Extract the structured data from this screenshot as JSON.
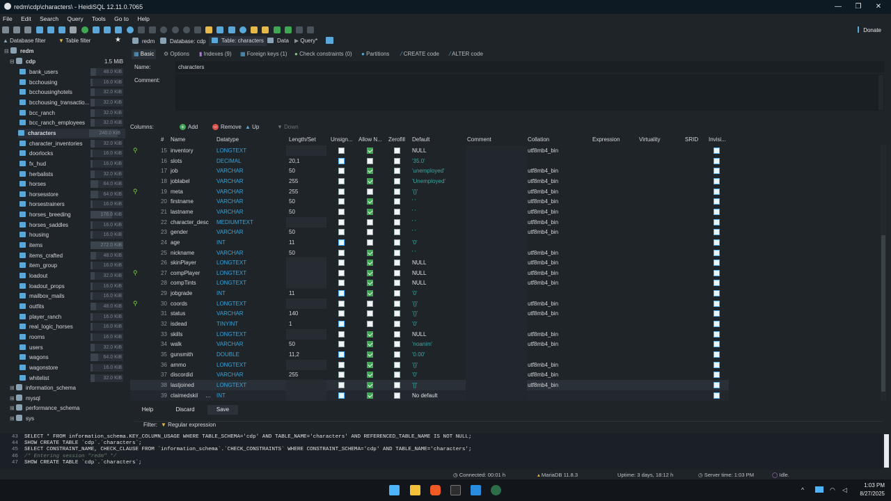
{
  "window": {
    "title": "redm\\cdp\\characters\\ - HeidiSQL 12.11.0.7065",
    "min": "—",
    "max": "❐",
    "close": "✕"
  },
  "menu": [
    "File",
    "Edit",
    "Search",
    "Query",
    "Tools",
    "Go to",
    "Help"
  ],
  "donate": "Donate",
  "navbar": {
    "db_filter": "Database filter",
    "table_filter": "Table filter",
    "redm": "redm",
    "database": "Database: cdp",
    "table": "Table: characters",
    "data": "Data",
    "query": "Query*"
  },
  "tree": {
    "root": "redm",
    "db": "cdp",
    "db_size": "1.5 MiB",
    "tables": [
      {
        "name": "bank_users",
        "size": "48.0 KiB",
        "fill": 0.18
      },
      {
        "name": "bcchousing",
        "size": "16.0 KiB",
        "fill": 0.06
      },
      {
        "name": "bcchousinghotels",
        "size": "32.0 KiB",
        "fill": 0.12
      },
      {
        "name": "bcchousing_transactio...",
        "size": "32.0 KiB",
        "fill": 0.12
      },
      {
        "name": "bcc_ranch",
        "size": "32.0 KiB",
        "fill": 0.12
      },
      {
        "name": "bcc_ranch_employees",
        "size": "32.0 KiB",
        "fill": 0.12
      },
      {
        "name": "characters",
        "size": "240.0 KiB",
        "fill": 0.88
      },
      {
        "name": "character_inventories",
        "size": "32.0 KiB",
        "fill": 0.12
      },
      {
        "name": "doorlocks",
        "size": "16.0 KiB",
        "fill": 0.06
      },
      {
        "name": "fx_hud",
        "size": "16.0 KiB",
        "fill": 0.06
      },
      {
        "name": "herbalists",
        "size": "32.0 KiB",
        "fill": 0.12
      },
      {
        "name": "horses",
        "size": "64.0 KiB",
        "fill": 0.24
      },
      {
        "name": "horsesstore",
        "size": "64.0 KiB",
        "fill": 0.24
      },
      {
        "name": "horsestrainers",
        "size": "16.0 KiB",
        "fill": 0.06
      },
      {
        "name": "horses_breeding",
        "size": "176.0 KiB",
        "fill": 0.65
      },
      {
        "name": "horses_saddles",
        "size": "16.0 KiB",
        "fill": 0.06
      },
      {
        "name": "housing",
        "size": "16.0 KiB",
        "fill": 0.06
      },
      {
        "name": "items",
        "size": "272.0 KiB",
        "fill": 1.0
      },
      {
        "name": "items_crafted",
        "size": "48.0 KiB",
        "fill": 0.18
      },
      {
        "name": "item_group",
        "size": "16.0 KiB",
        "fill": 0.06
      },
      {
        "name": "loadout",
        "size": "32.0 KiB",
        "fill": 0.12
      },
      {
        "name": "loadout_props",
        "size": "16.0 KiB",
        "fill": 0.06
      },
      {
        "name": "mailbox_mails",
        "size": "16.0 KiB",
        "fill": 0.06
      },
      {
        "name": "outfits",
        "size": "48.0 KiB",
        "fill": 0.18
      },
      {
        "name": "player_ranch",
        "size": "16.0 KiB",
        "fill": 0.06
      },
      {
        "name": "real_logic_horses",
        "size": "16.0 KiB",
        "fill": 0.06
      },
      {
        "name": "rooms",
        "size": "16.0 KiB",
        "fill": 0.06
      },
      {
        "name": "users",
        "size": "32.0 KiB",
        "fill": 0.12
      },
      {
        "name": "wagons",
        "size": "64.0 KiB",
        "fill": 0.24
      },
      {
        "name": "wagonstore",
        "size": "16.0 KiB",
        "fill": 0.06
      },
      {
        "name": "whitelist",
        "size": "32.0 KiB",
        "fill": 0.12
      }
    ],
    "other_dbs": [
      "information_schema",
      "mysql",
      "performance_schema",
      "sys"
    ]
  },
  "tabs": [
    "Basic",
    "Options",
    "Indexes (9)",
    "Foreign keys (1)",
    "Check constraints (0)",
    "Partitions",
    "CREATE code",
    "ALTER code"
  ],
  "form": {
    "name_label": "Name:",
    "name_value": "characters",
    "comment_label": "Comment:"
  },
  "columns_bar": {
    "label": "Columns:",
    "add": "Add",
    "remove": "Remove",
    "up": "Up",
    "down": "Down"
  },
  "grid_headers": [
    "#",
    "Name",
    "Datatype",
    "Length/Set",
    "Unsign...",
    "Allow N...",
    "Zerofill",
    "Default",
    "Comment",
    "Collation",
    "Expression",
    "Virtuality",
    "SRID",
    "Invisi..."
  ],
  "rows": [
    {
      "n": "15",
      "name": "inventory",
      "type": "LONGTEXT",
      "len": "",
      "uns": false,
      "null": true,
      "def": "NULL",
      "col": "utf8mb4_bin",
      "key": true
    },
    {
      "n": "16",
      "name": "slots",
      "type": "DECIMAL",
      "len": "20,1",
      "uns": true,
      "null": false,
      "def": "'35.0'",
      "col": "",
      "key": false
    },
    {
      "n": "17",
      "name": "job",
      "type": "VARCHAR",
      "len": "50",
      "uns": false,
      "null": true,
      "def": "'unemployed'",
      "col": "utf8mb4_bin",
      "key": false
    },
    {
      "n": "18",
      "name": "joblabel",
      "type": "VARCHAR",
      "len": "255",
      "uns": false,
      "null": true,
      "def": "'Unemployed'",
      "col": "utf8mb4_bin",
      "key": false
    },
    {
      "n": "19",
      "name": "meta",
      "type": "VARCHAR",
      "len": "255",
      "uns": false,
      "null": false,
      "def": "'{}'",
      "col": "utf8mb4_bin",
      "key": true
    },
    {
      "n": "20",
      "name": "firstname",
      "type": "VARCHAR",
      "len": "50",
      "uns": false,
      "null": true,
      "def": "' '",
      "col": "utf8mb4_bin",
      "key": false
    },
    {
      "n": "21",
      "name": "lastname",
      "type": "VARCHAR",
      "len": "50",
      "uns": false,
      "null": true,
      "def": "' '",
      "col": "utf8mb4_bin",
      "key": false
    },
    {
      "n": "22",
      "name": "character_desc",
      "type": "MEDIUMTEXT",
      "len": "",
      "uns": false,
      "null": false,
      "def": "' '",
      "col": "utf8mb4_bin",
      "key": false
    },
    {
      "n": "23",
      "name": "gender",
      "type": "VARCHAR",
      "len": "50",
      "uns": false,
      "null": false,
      "def": "' '",
      "col": "utf8mb4_bin",
      "key": false
    },
    {
      "n": "24",
      "name": "age",
      "type": "INT",
      "len": "11",
      "uns": true,
      "null": false,
      "def": "'0'",
      "col": "",
      "key": false
    },
    {
      "n": "25",
      "name": "nickname",
      "type": "VARCHAR",
      "len": "50",
      "uns": false,
      "null": true,
      "def": "' '",
      "col": "utf8mb4_bin",
      "key": false
    },
    {
      "n": "26",
      "name": "skinPlayer",
      "type": "LONGTEXT",
      "len": "",
      "uns": false,
      "null": true,
      "def": "NULL",
      "col": "utf8mb4_bin",
      "key": false
    },
    {
      "n": "27",
      "name": "compPlayer",
      "type": "LONGTEXT",
      "len": "",
      "uns": false,
      "null": true,
      "def": "NULL",
      "col": "utf8mb4_bin",
      "key": true
    },
    {
      "n": "28",
      "name": "compTints",
      "type": "LONGTEXT",
      "len": "",
      "uns": false,
      "null": true,
      "def": "NULL",
      "col": "utf8mb4_bin",
      "key": false
    },
    {
      "n": "29",
      "name": "jobgrade",
      "type": "INT",
      "len": "11",
      "uns": true,
      "null": true,
      "def": "'0'",
      "col": "",
      "key": false
    },
    {
      "n": "30",
      "name": "coords",
      "type": "LONGTEXT",
      "len": "",
      "uns": false,
      "null": false,
      "def": "'{}'",
      "col": "utf8mb4_bin",
      "key": true
    },
    {
      "n": "31",
      "name": "status",
      "type": "VARCHAR",
      "len": "140",
      "uns": false,
      "null": false,
      "def": "'{}'",
      "col": "utf8mb4_bin",
      "key": false
    },
    {
      "n": "32",
      "name": "isdead",
      "type": "TINYINT",
      "len": "1",
      "uns": true,
      "null": false,
      "def": "'0'",
      "col": "",
      "key": false
    },
    {
      "n": "33",
      "name": "skills",
      "type": "LONGTEXT",
      "len": "",
      "uns": false,
      "null": true,
      "def": "NULL",
      "col": "utf8mb4_bin",
      "key": false
    },
    {
      "n": "34",
      "name": "walk",
      "type": "VARCHAR",
      "len": "50",
      "uns": false,
      "null": true,
      "def": "'noanim'",
      "col": "utf8mb4_bin",
      "key": false
    },
    {
      "n": "35",
      "name": "gunsmith",
      "type": "DOUBLE",
      "len": "11,2",
      "uns": true,
      "null": true,
      "def": "'0.00'",
      "col": "",
      "key": false
    },
    {
      "n": "36",
      "name": "ammo",
      "type": "LONGTEXT",
      "len": "",
      "uns": false,
      "null": true,
      "def": "'{}'",
      "col": "utf8mb4_bin",
      "key": false
    },
    {
      "n": "37",
      "name": "discordid",
      "type": "VARCHAR",
      "len": "255",
      "uns": false,
      "null": true,
      "def": "'0'",
      "col": "utf8mb4_bin",
      "key": false
    },
    {
      "n": "38",
      "name": "lastjoined",
      "type": "LONGTEXT",
      "len": "",
      "uns": false,
      "null": true,
      "def": "'[]'",
      "col": "utf8mb4_bin",
      "key": false
    },
    {
      "n": "39",
      "name": "claimedskil",
      "type": "INT",
      "len": "",
      "uns": true,
      "null": true,
      "def": "No default",
      "col": "",
      "key": false
    }
  ],
  "buttons": {
    "help": "Help",
    "discard": "Discard",
    "save": "Save"
  },
  "filter": {
    "label": "Filter:",
    "regex": "Regular expression"
  },
  "sql_log": [
    {
      "n": "43",
      "code": "SELECT * FROM information_schema.KEY_COLUMN_USAGE WHERE   TABLE_SCHEMA='cdp'   AND TABLE_NAME='characters'   AND REFERENCED_TABLE_NAME IS NOT NULL;"
    },
    {
      "n": "44",
      "code": "SHOW CREATE TABLE `cdp`.`characters`;"
    },
    {
      "n": "45",
      "code": "SELECT CONSTRAINT_NAME, CHECK_CLAUSE FROM `information_schema`.`CHECK_CONSTRAINTS` WHERE CONSTRAINT_SCHEMA='cdp' AND TABLE_NAME='characters';"
    },
    {
      "n": "46",
      "code": "/* Entering session \"redm\" */"
    },
    {
      "n": "47",
      "code": "SHOW CREATE TABLE `cdp`.`characters`;"
    }
  ],
  "statusbar": {
    "connected": "Connected: 00:01 h",
    "server": "MariaDB 11.8.3",
    "uptime": "Uptime: 3 days, 18:12 h",
    "servertime": "Server time: 1:03 PM",
    "state": "Idle."
  },
  "clock": {
    "time": "1:03 PM",
    "date": "8/27/2025"
  },
  "colors": {
    "accent": "#4db4ff",
    "check": "#3fa653",
    "key": "#7fcc4a"
  }
}
